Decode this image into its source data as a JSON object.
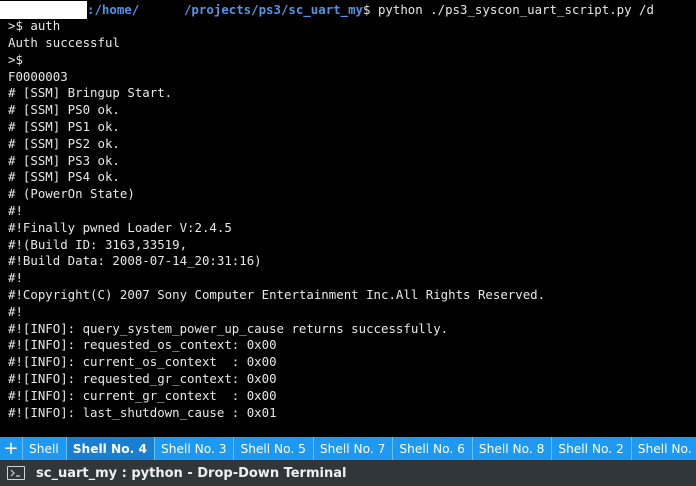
{
  "terminal": {
    "prompt": {
      "user_host": "",
      "path": ":/home/      /projects/ps3/sc_uart_my",
      "dollar": "$",
      "command": " python ./ps3_syscon_uart_script.py /d"
    },
    "lines": [
      ">$ auth",
      "Auth successful",
      ">$",
      "F0000003",
      "# [SSM] Bringup Start.",
      "# [SSM] PS0 ok.",
      "# [SSM] PS1 ok.",
      "# [SSM] PS2 ok.",
      "# [SSM] PS3 ok.",
      "# [SSM] PS4 ok.",
      "# (PowerOn State)",
      "#!",
      "#!Finally pwned Loader V:2.4.5",
      "#!(Build ID: 3163,33519,",
      "#!Build Data: 2008-07-14_20:31:16)",
      "#!",
      "#!Copyright(C) 2007 Sony Computer Entertainment Inc.All Rights Reserved.",
      "#!",
      "#![INFO]: query_system_power_up_cause returns successfully.",
      "#![INFO]: requested_os_context: 0x00",
      "#![INFO]: current_os_context  : 0x00",
      "#![INFO]: requested_gr_context: 0x00",
      "#![INFO]: current_gr_context  : 0x00",
      "#![INFO]: last_shutdown_cause : 0x01"
    ]
  },
  "tabs": {
    "add_label": "+",
    "items": [
      {
        "label": "Shell"
      },
      {
        "label": "Shell No. 4"
      },
      {
        "label": "Shell No. 3"
      },
      {
        "label": "Shell No. 5"
      },
      {
        "label": "Shell No. 7"
      },
      {
        "label": "Shell No. 6"
      },
      {
        "label": "Shell No. 8"
      },
      {
        "label": "Shell No. 2"
      },
      {
        "label": "Shell No. 9"
      },
      {
        "label": "Shell N"
      }
    ],
    "active_index": 1
  },
  "window": {
    "title": "sc_uart_my : python - Drop-Down Terminal",
    "icon": "terminal-icon"
  },
  "colors": {
    "terminal_bg": "#000000",
    "terminal_fg": "#e8e8e8",
    "path": "#5294e2",
    "tab_bar": "#1d99f3",
    "tab_active": "#1a7fd0",
    "title_bar": "#31363b"
  }
}
